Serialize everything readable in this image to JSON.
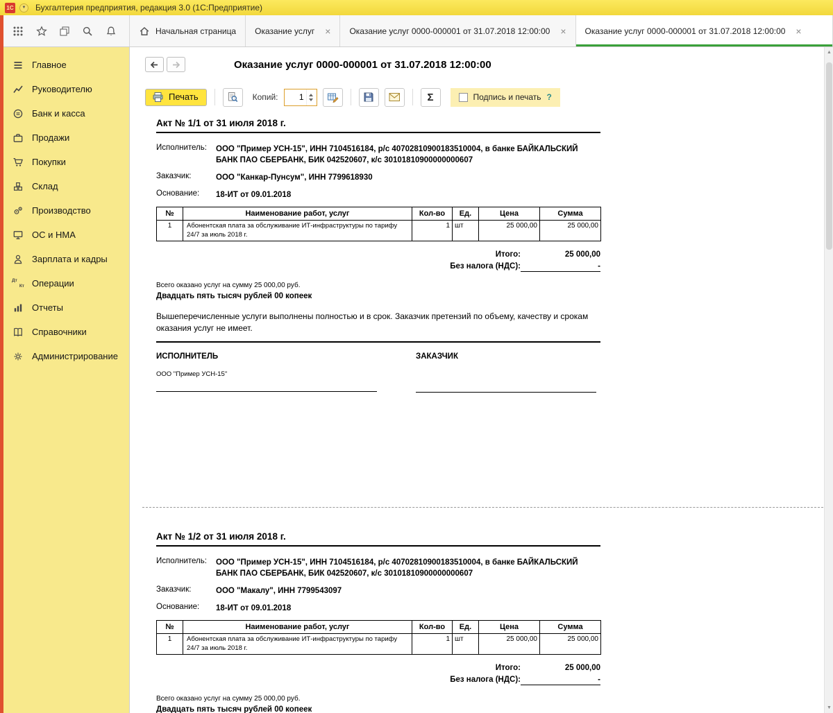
{
  "titlebar": {
    "logo_text": "1С",
    "title": "Бухгалтерия предприятия, редакция 3.0  (1С:Предприятие)"
  },
  "tabbar": {
    "home_label": "Начальная страница",
    "close_glyph": "×",
    "tabs": [
      {
        "label": "Оказание услуг"
      },
      {
        "label": "Оказание услуг 0000-000001 от 31.07.2018 12:00:00"
      },
      {
        "label": "Оказание услуг 0000-000001 от 31.07.2018 12:00:00"
      }
    ]
  },
  "sidebar": {
    "items": [
      "Главное",
      "Руководителю",
      "Банк и касса",
      "Продажи",
      "Покупки",
      "Склад",
      "Производство",
      "ОС и НМА",
      "Зарплата и кадры",
      "Операции",
      "Отчеты",
      "Справочники",
      "Администрирование"
    ],
    "operations_icon_top": "Дт",
    "operations_icon_bottom": "Кт"
  },
  "page": {
    "title": "Оказание услуг 0000-000001 от 31.07.2018 12:00:00"
  },
  "print_toolbar": {
    "print_label": "Печать",
    "copies_label": "Копий:",
    "copies_value": "1",
    "sigma_glyph": "Σ",
    "sign_and_print_label": "Подпись и печать",
    "help_glyph": "?"
  },
  "acts": [
    {
      "title": "Акт № 1/1 от 31 июля 2018 г.",
      "executor_label": "Исполнитель:",
      "executor": "ООО \"Пример УСН-15\", ИНН 7104516184, р/с 40702810900183510004, в банке БАЙКАЛЬСКИЙ БАНК ПАО СБЕРБАНК, БИК 042520607, к/с 30101810900000000607",
      "customer_label": "Заказчик:",
      "customer": "ООО \"Канкар-Пунсум\", ИНН 7799618930",
      "basis_label": "Основание:",
      "basis": "18-ИТ от 09.01.2018",
      "table": {
        "headers": [
          "№",
          "Наименование работ, услуг",
          "Кол-во",
          "Ед.",
          "Цена",
          "Сумма"
        ],
        "rows": [
          {
            "num": "1",
            "name": "Абонентская плата за обслуживание ИТ-инфраструктуры по тарифу 24/7 за июль 2018 г.",
            "qty": "1",
            "unit": "шт",
            "price": "25 000,00",
            "sum": "25 000,00"
          }
        ]
      },
      "total_label": "Итого:",
      "total_value": "25 000,00",
      "vat_label": "Без налога (НДС):",
      "vat_value": "-",
      "total_note": "Всего оказано услуг на сумму 25 000,00 руб.",
      "amount_in_words": "Двадцать пять тысяч рублей 00 копеек",
      "disclaimer": "Вышеперечисленные услуги выполнены полностью и в срок. Заказчик претензий по объему, качеству и срокам оказания услуг не имеет.",
      "executor_sign_title": "ИСПОЛНИТЕЛЬ",
      "customer_sign_title": "ЗАКАЗЧИК",
      "executor_sign_name": "ООО \"Пример УСН-15\""
    },
    {
      "title": "Акт № 1/2 от 31 июля 2018 г.",
      "executor_label": "Исполнитель:",
      "executor": "ООО \"Пример УСН-15\", ИНН 7104516184, р/с 40702810900183510004, в банке БАЙКАЛЬСКИЙ БАНК ПАО СБЕРБАНК, БИК 042520607, к/с 30101810900000000607",
      "customer_label": "Заказчик:",
      "customer": "ООО \"Макалу\", ИНН 7799543097",
      "basis_label": "Основание:",
      "basis": "18-ИТ от 09.01.2018",
      "table": {
        "headers": [
          "№",
          "Наименование работ, услуг",
          "Кол-во",
          "Ед.",
          "Цена",
          "Сумма"
        ],
        "rows": [
          {
            "num": "1",
            "name": "Абонентская плата за обслуживание ИТ-инфраструктуры по тарифу 24/7 за июль 2018 г.",
            "qty": "1",
            "unit": "шт",
            "price": "25 000,00",
            "sum": "25 000,00"
          }
        ]
      },
      "total_label": "Итого:",
      "total_value": "25 000,00",
      "vat_label": "Без налога (НДС):",
      "vat_value": "-",
      "total_note": "Всего оказано услуг на сумму 25 000,00 руб.",
      "amount_in_words": "Двадцать пять тысяч рублей 00 копеек"
    }
  ]
}
